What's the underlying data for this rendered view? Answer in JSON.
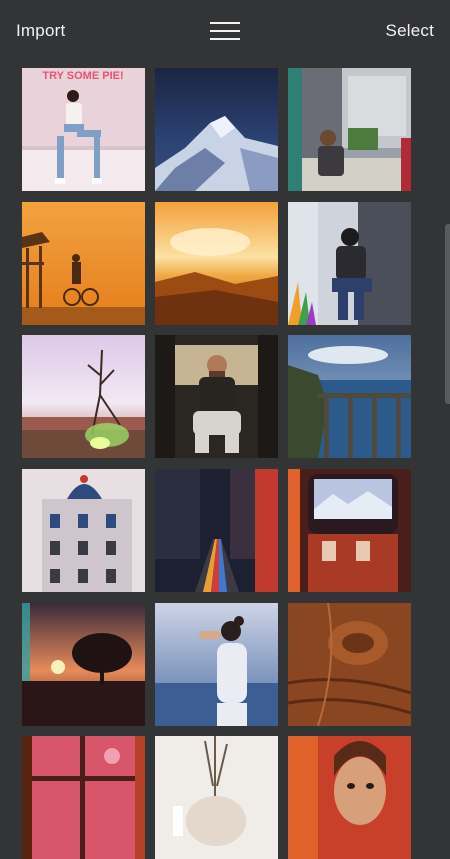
{
  "header": {
    "import_label": "Import",
    "select_label": "Select",
    "menu_icon": "hamburger-menu-icon"
  },
  "photos": [
    {
      "subject": "woman-sitting-neon-wall",
      "caption": "TRY SOME PIE!"
    },
    {
      "subject": "snowy-mountain-peak"
    },
    {
      "subject": "woman-at-table-window"
    },
    {
      "subject": "lifeguard-tower-cyclist-sunset"
    },
    {
      "subject": "orange-sunset-landscape"
    },
    {
      "subject": "woman-sitting-rock-wall"
    },
    {
      "subject": "dry-plant-field-sun"
    },
    {
      "subject": "bearded-man-sitting-van"
    },
    {
      "subject": "bridge-coastline"
    },
    {
      "subject": "ornate-building-facade"
    },
    {
      "subject": "street-colorful-lines"
    },
    {
      "subject": "window-mountain-view"
    },
    {
      "subject": "tree-silhouette-sunset"
    },
    {
      "subject": "woman-hair-bun-sky"
    },
    {
      "subject": "wood-grain-texture"
    },
    {
      "subject": "window-pane-flowers"
    },
    {
      "subject": "dried-flowers-vase"
    },
    {
      "subject": "portrait-woman-red"
    }
  ],
  "colors": {
    "background": "#333436",
    "header_text": "#f2f2f2"
  }
}
